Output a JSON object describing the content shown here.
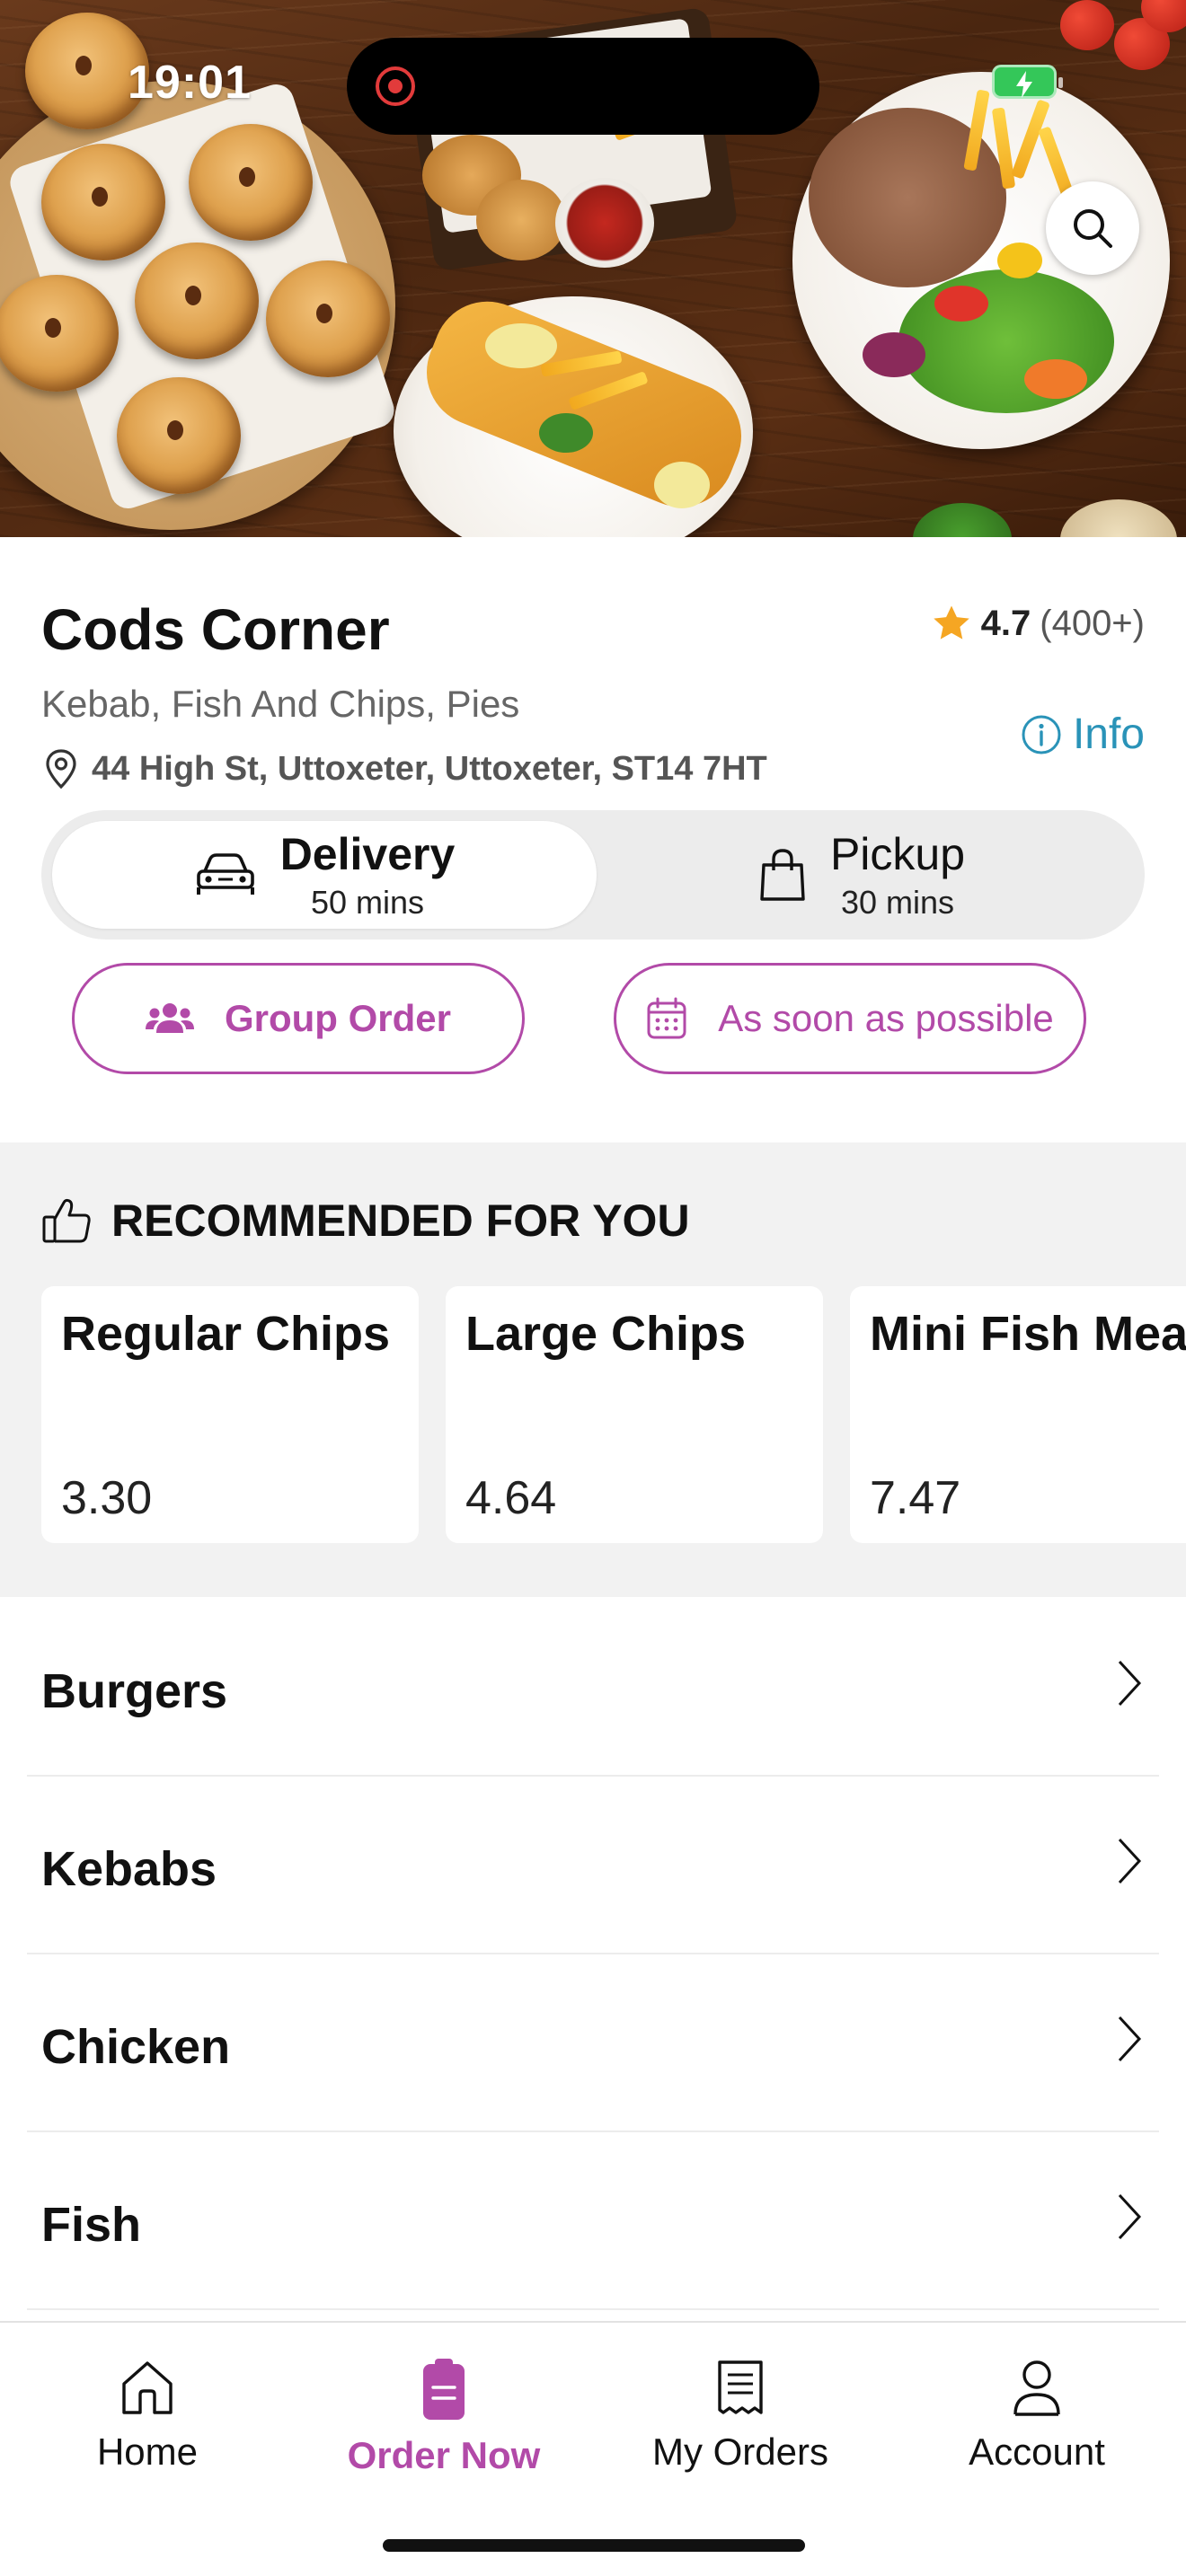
{
  "status_bar": {
    "time": "19:01"
  },
  "store": {
    "name": "Cods Corner",
    "rating": "4.7",
    "rating_count": "(400+)",
    "cuisines": "Kebab, Fish And Chips, Pies",
    "address": "44 High St, Uttoxeter, Uttoxeter, ST14 7HT",
    "info_label": "Info"
  },
  "order_mode": {
    "delivery": {
      "label": "Delivery",
      "time": "50 mins",
      "selected": true
    },
    "pickup": {
      "label": "Pickup",
      "time": "30 mins",
      "selected": false
    }
  },
  "actions": {
    "group_order_label": "Group Order",
    "schedule_label": "As soon as possible"
  },
  "recommended": {
    "title": "RECOMMENDED FOR YOU",
    "items": [
      {
        "name": "Regular Chips",
        "price": "3.30"
      },
      {
        "name": "Large Chips",
        "price": "4.64"
      },
      {
        "name": "Mini Fish Meal",
        "price": "7.47"
      }
    ]
  },
  "categories": [
    {
      "label": "Burgers"
    },
    {
      "label": "Kebabs"
    },
    {
      "label": "Chicken"
    },
    {
      "label": "Fish"
    }
  ],
  "tabbar": {
    "items": [
      {
        "label": "Home",
        "icon": "home-icon",
        "active": false
      },
      {
        "label": "Order Now",
        "icon": "order-icon",
        "active": true
      },
      {
        "label": "My Orders",
        "icon": "receipt-icon",
        "active": false
      },
      {
        "label": "Account",
        "icon": "user-icon",
        "active": false
      }
    ]
  },
  "colors": {
    "accent": "#b24aa8",
    "info": "#2a93b8",
    "star": "#f5a623",
    "section_bg": "#f2f2f2"
  }
}
